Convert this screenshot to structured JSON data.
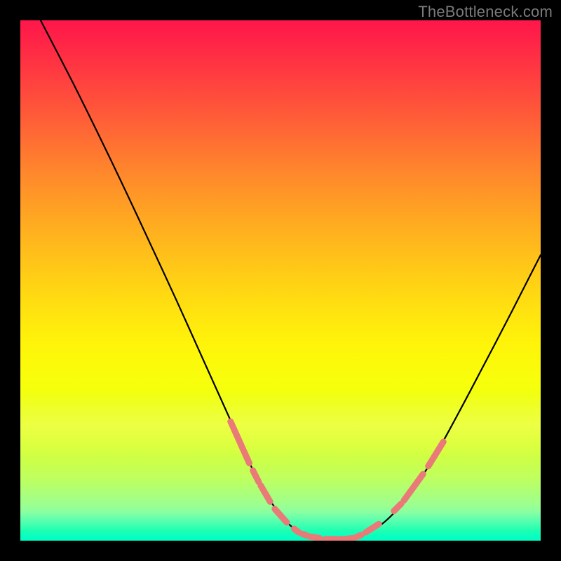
{
  "watermark": {
    "text": "TheBottleneck.com"
  },
  "colors": {
    "curve": "#000000",
    "marker": "#e97a78",
    "gradient_top": "#ff164b",
    "gradient_bottom": "#00ffd0"
  },
  "chart_data": {
    "type": "line",
    "title": "",
    "xlabel": "",
    "ylabel": "",
    "xlim": [
      0,
      100
    ],
    "ylim": [
      0,
      100
    ],
    "grid": false,
    "series": [
      {
        "name": "left-curve",
        "x": [
          3.9,
          10,
          15,
          20,
          25,
          30,
          35,
          40,
          44.5,
          48,
          51.8,
          54.6,
          56.3,
          58.3
        ],
        "y": [
          100,
          88.2,
          78.1,
          67.7,
          57.0,
          46.2,
          35.1,
          24.0,
          14.0,
          7.7,
          3.0,
          1.2,
          0.6,
          0.3
        ]
      },
      {
        "name": "right-curve",
        "x": [
          62.5,
          64.9,
          67.9,
          71.5,
          75.7,
          80.0,
          84.3,
          88.9,
          93.5,
          98.1,
          100
        ],
        "y": [
          0.3,
          0.8,
          2.1,
          5.0,
          10.1,
          16.9,
          24.7,
          33.4,
          42.2,
          51.2,
          54.9
        ]
      }
    ],
    "markers": [
      {
        "name": "left-dashes",
        "segments": [
          {
            "x1": 40.4,
            "y1": 22.9,
            "x2": 44.0,
            "y2": 14.9
          },
          {
            "x1": 44.7,
            "y1": 13.5,
            "x2": 45.8,
            "y2": 11.3
          },
          {
            "x1": 46.2,
            "y1": 10.6,
            "x2": 48.0,
            "y2": 7.5
          },
          {
            "x1": 48.9,
            "y1": 6.1,
            "x2": 51.2,
            "y2": 3.5
          },
          {
            "x1": 52.6,
            "y1": 2.3,
            "x2": 53.5,
            "y2": 1.6
          },
          {
            "x1": 54.2,
            "y1": 1.3,
            "x2": 55.0,
            "y2": 1.0
          },
          {
            "x1": 55.6,
            "y1": 0.8,
            "x2": 57.5,
            "y2": 0.5
          },
          {
            "x1": 58.6,
            "y1": 0.3,
            "x2": 60.8,
            "y2": 0.3
          },
          {
            "x1": 61.5,
            "y1": 0.3,
            "x2": 62.6,
            "y2": 0.3
          }
        ]
      },
      {
        "name": "right-dashes",
        "segments": [
          {
            "x1": 63.1,
            "y1": 0.4,
            "x2": 64.0,
            "y2": 0.5
          },
          {
            "x1": 64.6,
            "y1": 0.7,
            "x2": 65.5,
            "y2": 1.1
          },
          {
            "x1": 66.4,
            "y1": 1.6,
            "x2": 68.9,
            "y2": 3.2
          },
          {
            "x1": 71.8,
            "y1": 5.7,
            "x2": 73.2,
            "y2": 7.1
          },
          {
            "x1": 73.7,
            "y1": 7.7,
            "x2": 77.4,
            "y2": 12.8
          },
          {
            "x1": 78.4,
            "y1": 14.3,
            "x2": 81.3,
            "y2": 19.0
          }
        ]
      }
    ]
  }
}
